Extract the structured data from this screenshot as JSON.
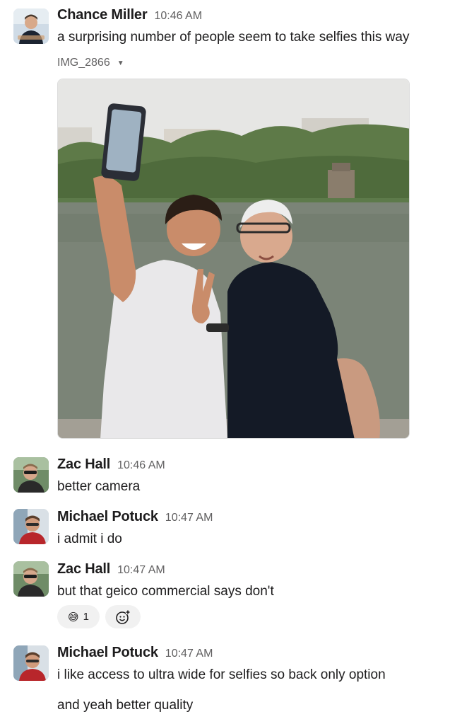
{
  "messages": [
    {
      "author": "Chance Miller",
      "time": "10:46 AM",
      "text": "a surprising number of people seem to take selfies this way",
      "attachment": {
        "filename": "IMG_2866"
      }
    },
    {
      "author": "Zac Hall",
      "time": "10:46 AM",
      "text": "better camera"
    },
    {
      "author": "Michael Potuck",
      "time": "10:47 AM",
      "text": "i admit i do"
    },
    {
      "author": "Zac Hall",
      "time": "10:47 AM",
      "text": "but that geico commercial says don't",
      "reactions": [
        {
          "emoji": "😅",
          "count": "1"
        }
      ]
    },
    {
      "author": "Michael Potuck",
      "time": "10:47 AM",
      "text": "i like access to ultra wide for selfies so back only option",
      "continuation": "and yeah better quality"
    }
  ],
  "colors": {
    "text": "#1d1c1d",
    "muted": "#616061",
    "reaction_bg": "#f1f1f1"
  },
  "icons": {
    "attachment_menu": "caret-down-icon",
    "add_reaction": "add-reaction-icon"
  }
}
